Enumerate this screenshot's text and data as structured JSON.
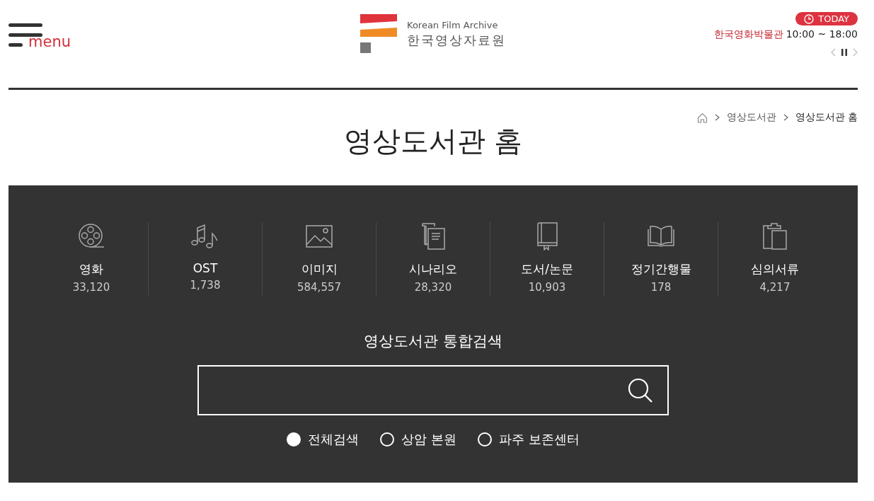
{
  "header": {
    "menu_label": "menu",
    "logo": {
      "english": "Korean Film Archive",
      "korean": "한국영상자료원"
    },
    "today": {
      "badge": "TODAY",
      "venue": "한국영화박물관",
      "hours": "10:00 ~ 18:00"
    }
  },
  "breadcrumb": [
    {
      "label": "영상도서관",
      "current": false
    },
    {
      "label": "영상도서관 홈",
      "current": true
    }
  ],
  "page_title": "영상도서관 홈",
  "categories": [
    {
      "label": "영화",
      "count": "33,120"
    },
    {
      "label": "OST",
      "count": "1,738"
    },
    {
      "label": "이미지",
      "count": "584,557"
    },
    {
      "label": "시나리오",
      "count": "28,320"
    },
    {
      "label": "도서/논문",
      "count": "10,903"
    },
    {
      "label": "정기간행물",
      "count": "178"
    },
    {
      "label": "심의서류",
      "count": "4,217"
    }
  ],
  "search": {
    "title": "영상도서관 통합검색",
    "scopes": [
      {
        "label": "전체검색",
        "selected": true
      },
      {
        "label": "상암 본원",
        "selected": false
      },
      {
        "label": "파주 보존센터",
        "selected": false
      }
    ]
  }
}
